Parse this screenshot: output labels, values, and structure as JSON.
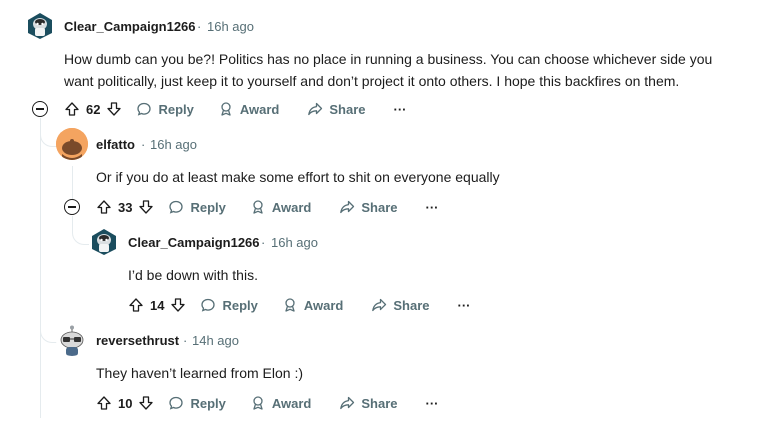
{
  "comments": [
    {
      "author": "Clear_Campaign1266",
      "time": "16h ago",
      "body_line1": "How dumb can you be?! Politics has no place in running a business. You can choose whichever side you",
      "body_line2": "want politically, just keep it to yourself and don’t project it onto others. I hope this backfires on them.",
      "votes": "62",
      "avatar": "snoo-avatar-icon"
    },
    {
      "author": "elfatto",
      "time": "16h ago",
      "body": "Or if you do at least make some effort to shit on everyone equally",
      "votes": "33",
      "avatar": "default-snoo-icon"
    },
    {
      "author": "Clear_Campaign1266",
      "time": "16h ago",
      "body": "I’d be down with this.",
      "votes": "14",
      "avatar": "snoo-avatar-icon"
    },
    {
      "author": "reversethrust",
      "time": "14h ago",
      "body": "They haven’t learned from Elon :)",
      "votes": "10",
      "avatar": "glasses-snoo-icon"
    }
  ],
  "actions": {
    "reply": "Reply",
    "award": "Award",
    "share": "Share",
    "more": "···"
  },
  "separator": "·",
  "colors": {
    "meta": "#576f76",
    "thread_line": "#e5ebee",
    "elfatto_avatar_bg": "#f4a460",
    "snoo_bg": "#1b4d5e"
  }
}
